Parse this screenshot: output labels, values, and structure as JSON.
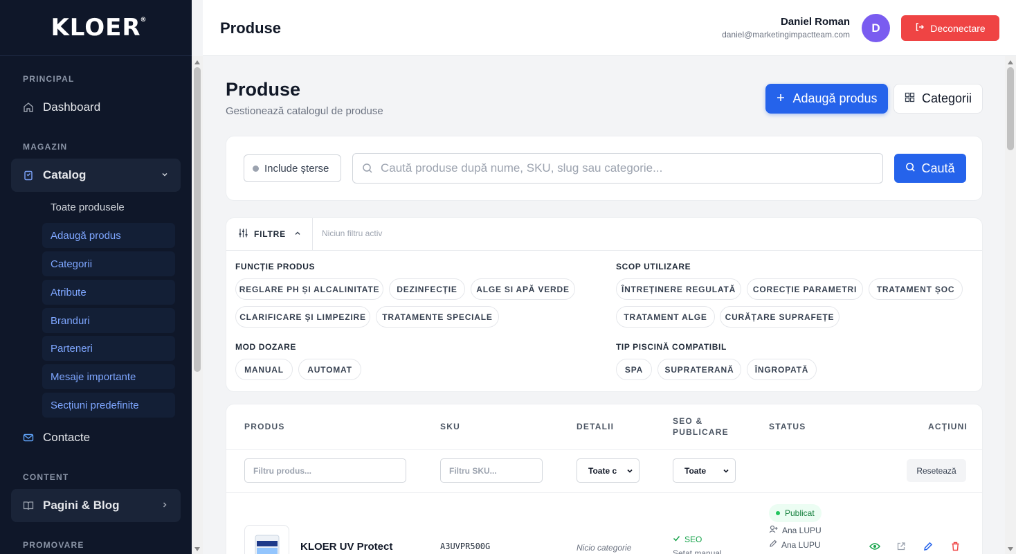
{
  "app": {
    "logo": "KLOER",
    "logo_mark": "®"
  },
  "header": {
    "title": "Produse",
    "user_name": "Daniel Roman",
    "user_email": "daniel@marketingimpactteam.com",
    "avatar_initial": "D",
    "logout_label": "Deconectare"
  },
  "sidebar": {
    "section_principal": "PRINCIPAL",
    "dashboard": "Dashboard",
    "section_magazin": "MAGAZIN",
    "catalog": "Catalog",
    "catalog_sub": [
      "Toate produsele",
      "Adaugă produs",
      "Categorii",
      "Atribute",
      "Branduri",
      "Parteneri",
      "Mesaje importante",
      "Secțiuni predefinite"
    ],
    "contacte": "Contacte",
    "section_content": "CONTENT",
    "pagini_blog": "Pagini & Blog",
    "section_promovare": "PROMOVARE"
  },
  "page": {
    "title": "Produse",
    "subtitle": "Gestionează catalogul de produse",
    "add_button": "Adaugă produs",
    "categories_button": "Categorii"
  },
  "search": {
    "include_deleted": "Include șterse",
    "placeholder": "Caută produse după nume, SKU, slug sau categorie...",
    "button": "Caută"
  },
  "filters": {
    "toggle_label": "FILTRE",
    "status": "Niciun filtru activ",
    "groups": {
      "functie": {
        "label": "FUNCȚIE PRODUS",
        "chips": [
          "REGLARE PH ȘI ALCALINITATE",
          "DEZINFECȚIE",
          "ALGE SI APĂ VERDE",
          "CLARIFICARE ȘI LIMPEZIRE",
          "TRATAMENTE SPECIALE"
        ]
      },
      "scop": {
        "label": "SCOP UTILIZARE",
        "chips": [
          "ÎNTREȚINERE REGULATĂ",
          "CORECȚIE PARAMETRI",
          "TRATAMENT ȘOC",
          "TRATAMENT ALGE",
          "CURĂȚARE SUPRAFEȚE"
        ]
      },
      "dozare": {
        "label": "MOD DOZARE",
        "chips": [
          "MANUAL",
          "AUTOMAT"
        ]
      },
      "piscina": {
        "label": "TIP PISCINĂ COMPATIBIL",
        "chips": [
          "SPA",
          "SUPRATERANĂ",
          "ÎNGROPATĂ"
        ]
      }
    }
  },
  "table": {
    "headers": {
      "produs": "PRODUS",
      "sku": "SKU",
      "detalii": "DETALII",
      "seo_line1": "SEO &",
      "seo_line2": "PUBLICARE",
      "status": "STATUS",
      "actiuni": "ACȚIUNI"
    },
    "filter_row": {
      "produs_placeholder": "Filtru produs...",
      "sku_placeholder": "Filtru SKU...",
      "detalii_select": "Toate c",
      "seo_select": "Toate",
      "reset": "Resetează"
    },
    "rows": [
      {
        "name": "KLOER UV Protect",
        "sku": "A3UVPR500G",
        "category": "Nicio categorie",
        "seo": "SEO",
        "seo_note": "Setat manual",
        "status": "Publicat",
        "created_by": "Ana LUPU",
        "edited_by": "Ana LUPU"
      }
    ]
  },
  "colors": {
    "sidebar_bg": "#0f1729",
    "primary": "#2563eb",
    "danger": "#ef4444",
    "avatar": "#7a5cf0",
    "success": "#16a34a"
  }
}
